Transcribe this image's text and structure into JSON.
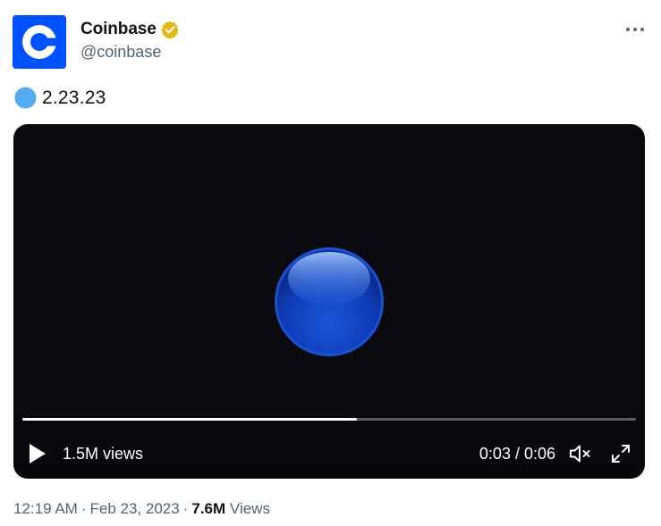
{
  "author": {
    "display_name": "Coinbase",
    "handle": "@coinbase",
    "avatar_icon": "coinbase-c-logo",
    "verified_icon": "verified-badge-gold",
    "brand_color": "#0052ff"
  },
  "tweet": {
    "emoji": "blue-circle",
    "text": "2.23.23"
  },
  "video": {
    "views_overlay": "1.5M views",
    "time": "0:03 / 0:06",
    "progress": 0.545,
    "play_icon": "play-icon",
    "mute_icon": "muted-speaker-icon",
    "fullscreen_icon": "fullscreen-icon"
  },
  "meta": {
    "time": "12:19 AM",
    "date": "Feb 23, 2023",
    "views_count": "7.6M",
    "views_label": "Views"
  },
  "colors": {
    "text_primary": "#0f1419",
    "text_secondary": "#536471",
    "video_bg": "#0a0a10"
  }
}
